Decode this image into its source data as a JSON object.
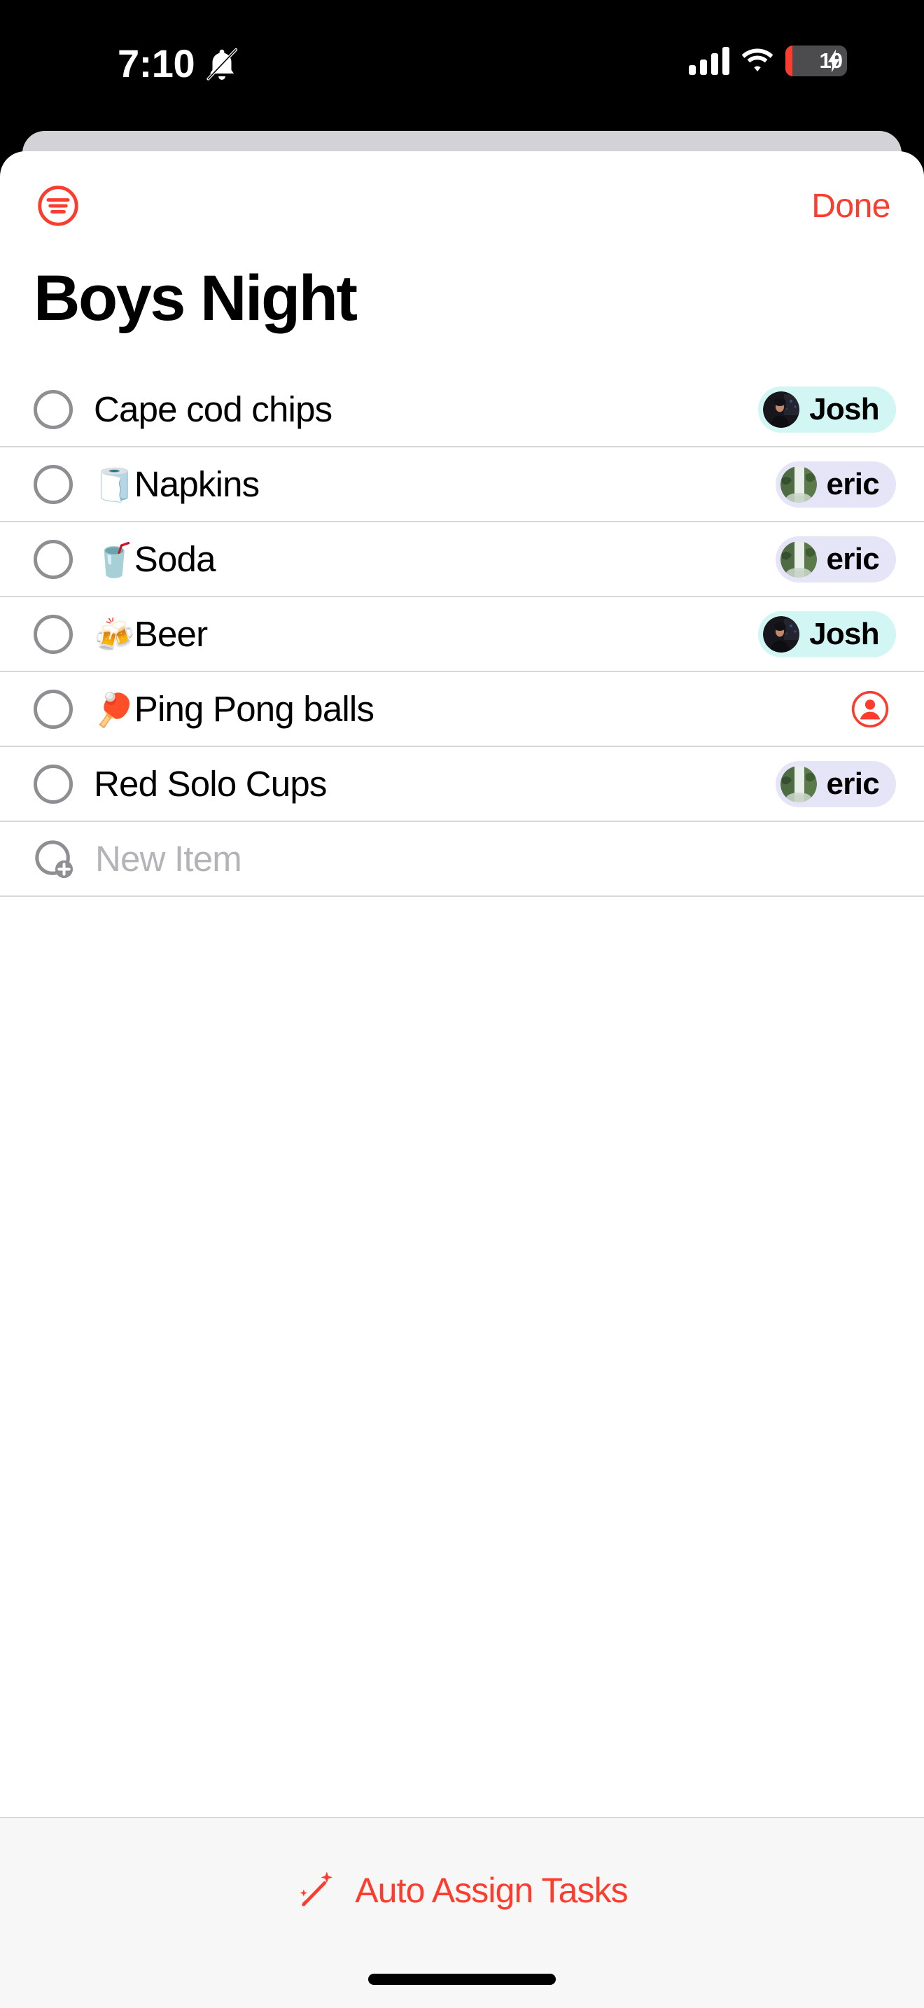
{
  "status_bar": {
    "time": "7:10",
    "silent_icon": "bell-slash-icon",
    "cellular_icon": "cellular-bars-icon",
    "wifi_icon": "wifi-icon",
    "battery_level": "10",
    "battery_charging": true,
    "battery_low_color": "#fc3d2e"
  },
  "theme": {
    "accent": "#fc3d2e",
    "separator": "#d8d8d8",
    "chip_cyan": "#d2f6f4",
    "chip_lavender": "#e6e4f7",
    "bottom_bar_bg": "#f7f7f7",
    "sheet_behind": "#d2d2d7"
  },
  "nav": {
    "menu_icon": "list-circle-icon",
    "done_label": "Done"
  },
  "header": {
    "title": "Boys Night"
  },
  "list": {
    "items": [
      {
        "emoji": "",
        "label": "Cape cod chips",
        "checked": false,
        "assignee": "Josh",
        "chip_color": "#d2f6f4",
        "avatar": "josh-photo"
      },
      {
        "emoji": "🧻",
        "label": "Napkins",
        "checked": false,
        "assignee": "eric",
        "chip_color": "#e6e4f7",
        "avatar": "eric-photo"
      },
      {
        "emoji": "🥤",
        "label": "Soda",
        "checked": false,
        "assignee": "eric",
        "chip_color": "#e6e4f7",
        "avatar": "eric-photo"
      },
      {
        "emoji": "🍻",
        "label": "Beer",
        "checked": false,
        "assignee": "Josh",
        "chip_color": "#d2f6f4",
        "avatar": "josh-photo"
      },
      {
        "emoji": "🏓",
        "label": "Ping Pong balls",
        "checked": false,
        "assignee": null,
        "chip_color": null,
        "avatar": null
      },
      {
        "emoji": "",
        "label": "Red Solo Cups",
        "checked": false,
        "assignee": "eric",
        "chip_color": "#e6e4f7",
        "avatar": "eric-photo"
      }
    ],
    "new_item_placeholder": "New Item"
  },
  "bottom_bar": {
    "auto_assign_label": "Auto Assign Tasks",
    "auto_assign_icon": "magic-wand-sparkles-icon"
  }
}
